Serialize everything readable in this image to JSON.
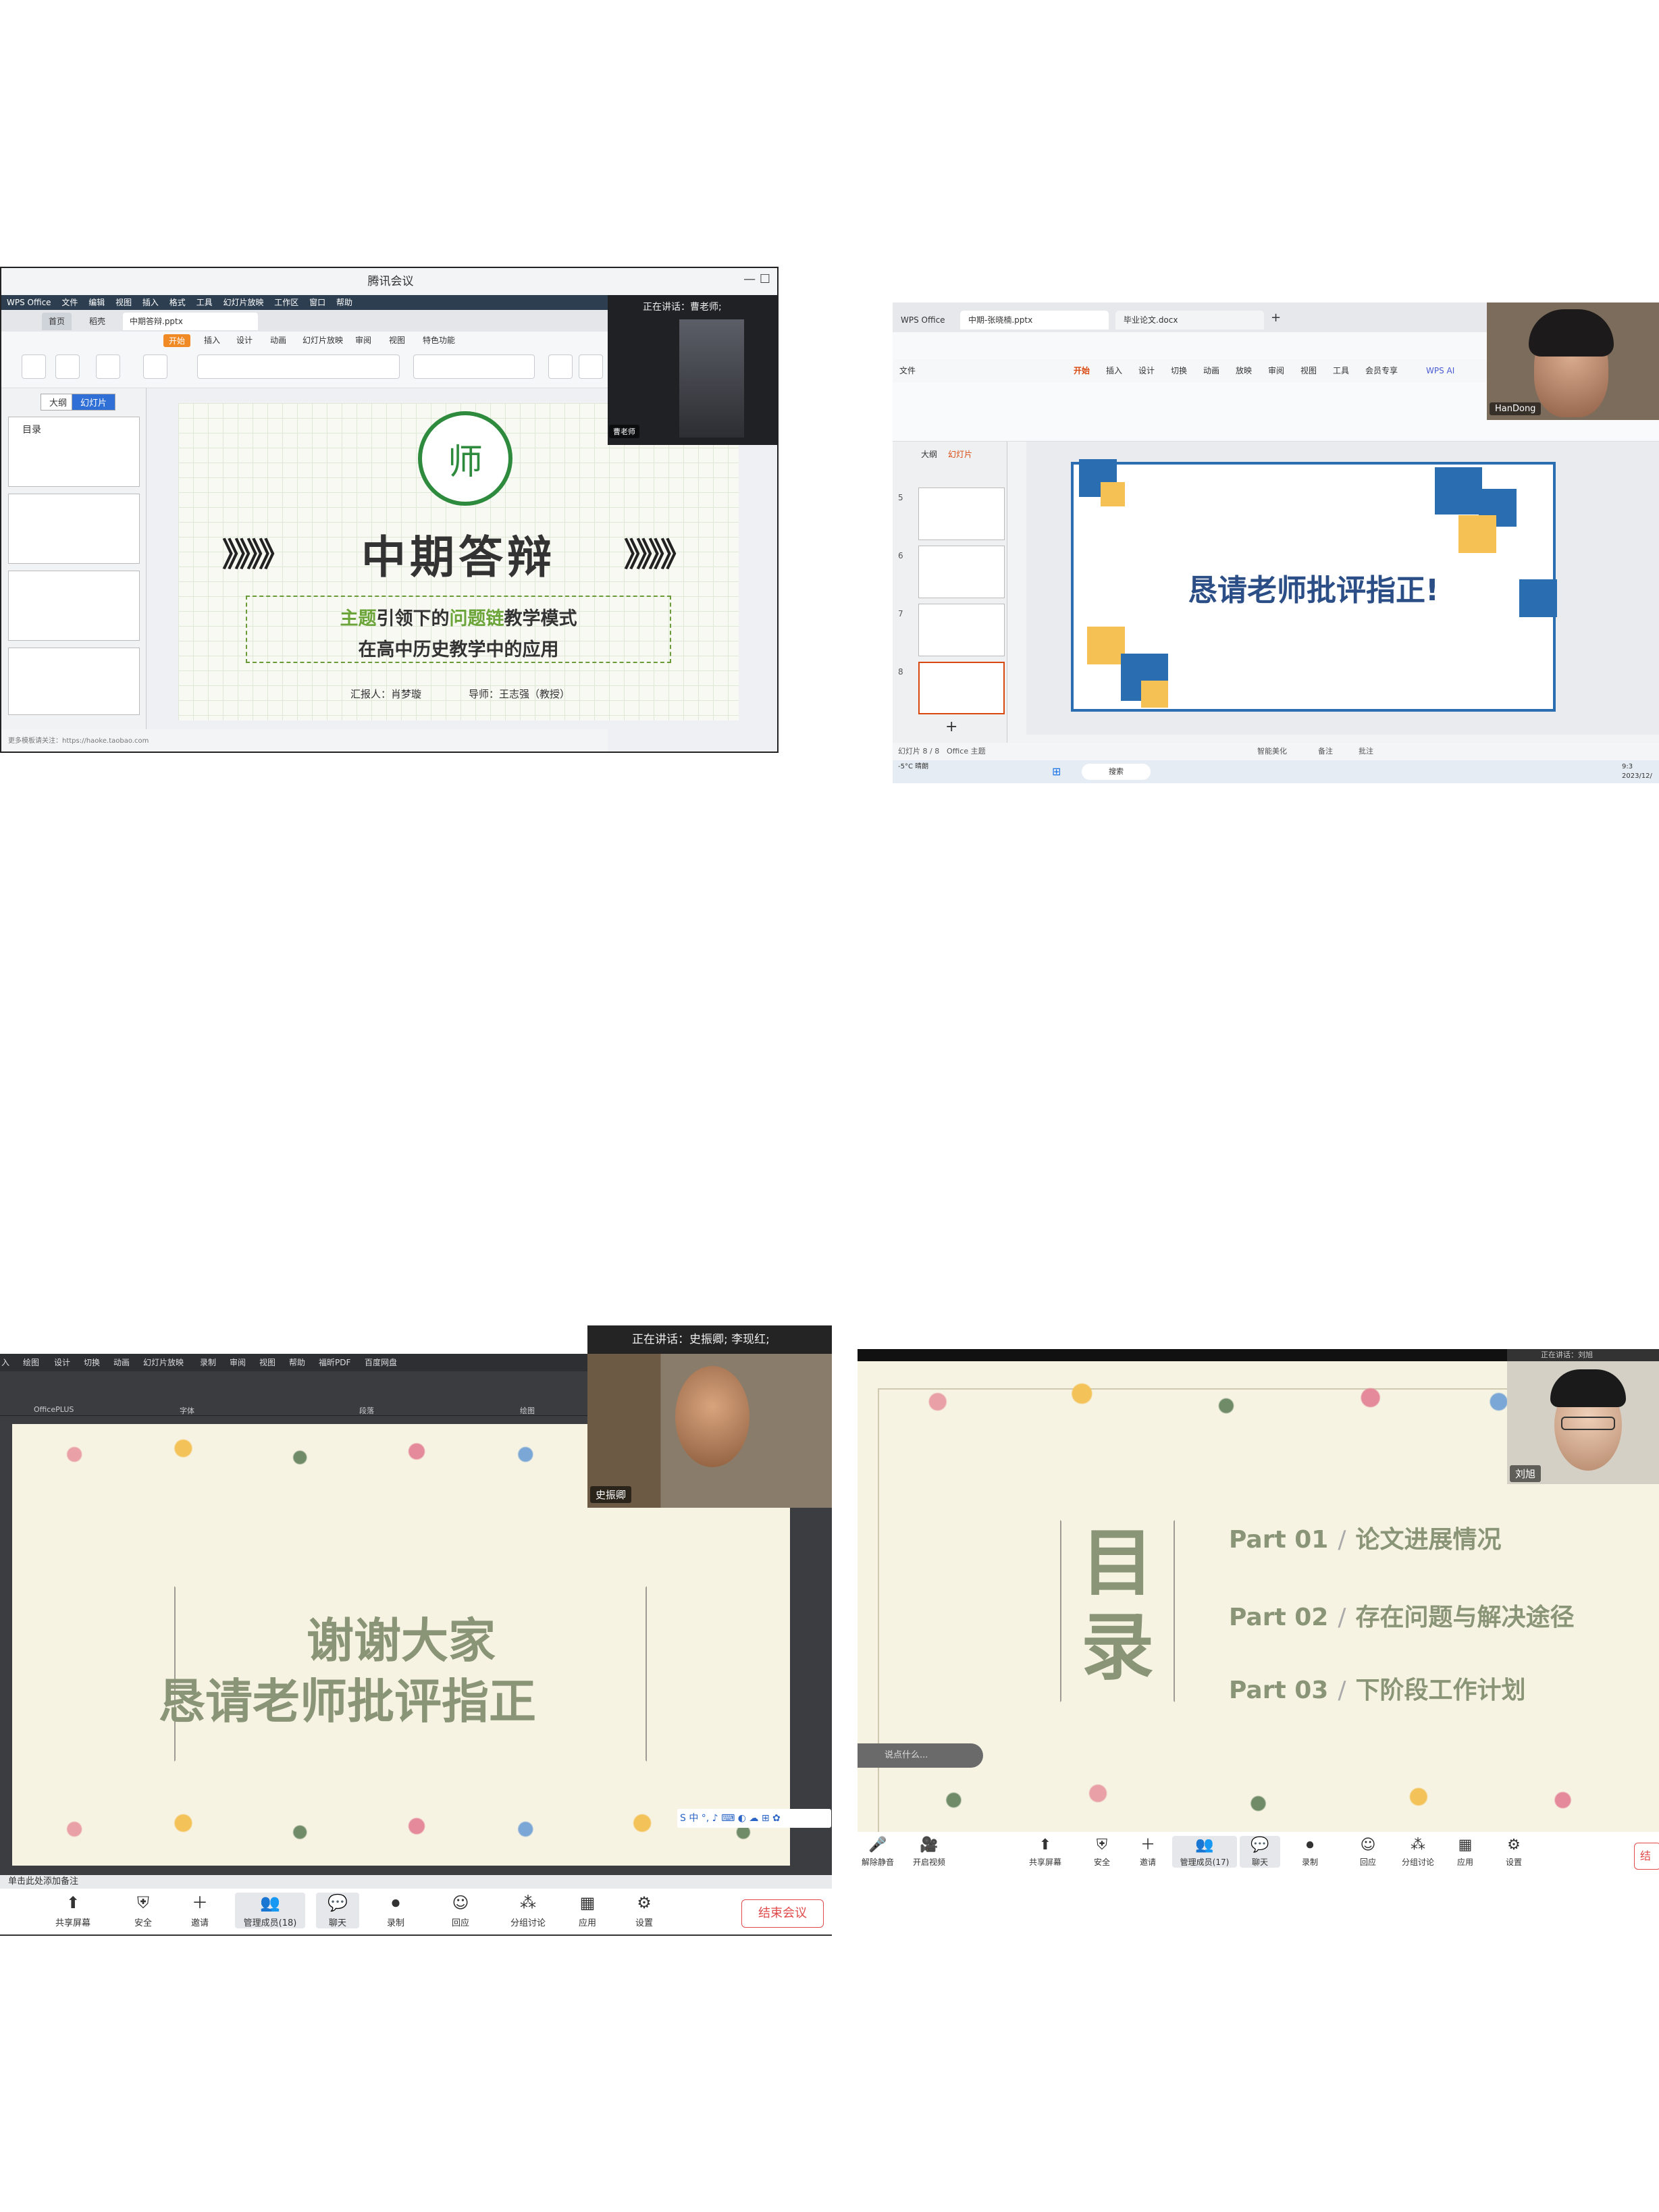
{
  "panel1": {
    "window_title": "腾讯会议",
    "menubar": [
      "WPS Office",
      "文件",
      "编辑",
      "视图",
      "插入",
      "格式",
      "工具",
      "幻灯片放映",
      "工作区",
      "窗口",
      "帮助"
    ],
    "tabs": [
      {
        "label": "首页"
      },
      {
        "label": "稻壳"
      },
      {
        "label": "中期答辩.pptx"
      }
    ],
    "ribbon_tabs": [
      "开始",
      "插入",
      "设计",
      "动画",
      "幻灯片放映",
      "审阅",
      "视图",
      "特色功能"
    ],
    "ribbon_active": "开始",
    "sidebar_tabs": [
      "大纲",
      "幻灯片"
    ],
    "thumb_labels": [
      "目录"
    ],
    "slide": {
      "logo_glyph": "师",
      "title": "中期答辩",
      "chevrons": "》》》》",
      "subtitle_pre": "主题",
      "subtitle_mid1": "引领下的",
      "subtitle_hl": "问题链",
      "subtitle_post": "教学模式",
      "subtitle_line2": "在高中历史教学中的应用",
      "reporter": "汇报人：肖梦璇",
      "advisor": "导师：王志强（教授）"
    },
    "status": "更多模板请关注：https://haoke.taobao.com",
    "video": {
      "speaking": "正在讲话：曹老师;",
      "name": "曹老师"
    }
  },
  "panel2": {
    "file_tabs": [
      "WPS Office",
      "中期-张晓楠.pptx",
      "毕业论文.docx"
    ],
    "menu": [
      "文件",
      "开始",
      "插入",
      "设计",
      "切换",
      "动画",
      "放映",
      "审阅",
      "视图",
      "工具",
      "会员专享",
      "WPS AI"
    ],
    "active_menu": "开始",
    "side_tabs": [
      "大纲",
      "幻灯片"
    ],
    "slide_numbers": [
      "5",
      "6",
      "7",
      "8"
    ],
    "slide_text": "恳请老师批评指正!",
    "status_left": "幻灯片 8 / 8",
    "status_theme": "Office 主题",
    "status_right": [
      "智能美化",
      "备注",
      "批注"
    ],
    "taskbar_search": "搜索",
    "taskbar_weather": "-5°C 晴朗",
    "taskbar_time": "9:3",
    "taskbar_date": "2023/12/",
    "video": {
      "name": "HanDong"
    },
    "accent_blue": "#2b6db1",
    "accent_orange": "#f5c054"
  },
  "panel3": {
    "menu": [
      "入",
      "绘图",
      "设计",
      "切换",
      "动画",
      "幻灯片放映",
      "录制",
      "审阅",
      "视图",
      "帮助",
      "福昕PDF",
      "百度网盘"
    ],
    "group_labels": [
      "OfficePLUS",
      "字体",
      "段落",
      "绘图"
    ],
    "slide_line1": "谢谢大家",
    "slide_line2": "恳请老师批评指正",
    "note": "单击此处添加备注",
    "ime": "S 中 °, ♪ ⌨ ◐ ☁ ⊞ ✿",
    "video": {
      "speaking": "正在讲话：史振卿; 李现红;",
      "name": "史振卿"
    },
    "toolbar": [
      {
        "label": "共享屏幕",
        "icon": "⬆"
      },
      {
        "label": "安全",
        "icon": "⛨"
      },
      {
        "label": "邀请",
        "icon": "＋"
      },
      {
        "label": "管理成员(18)",
        "icon": "👥"
      },
      {
        "label": "聊天",
        "icon": "💬"
      },
      {
        "label": "录制",
        "icon": "⏺"
      },
      {
        "label": "回应",
        "icon": "☺"
      },
      {
        "label": "分组讨论",
        "icon": "⁂"
      },
      {
        "label": "应用",
        "icon": "▦"
      },
      {
        "label": "设置",
        "icon": "⚙"
      }
    ],
    "end_label": "结束会议"
  },
  "panel4": {
    "mulu": [
      "目",
      "录"
    ],
    "parts": [
      {
        "num": "Part 01",
        "title": "论文进展情况"
      },
      {
        "num": "Part 02",
        "title": "存在问题与解决途径"
      },
      {
        "num": "Part 03",
        "title": "下阶段工作计划"
      }
    ],
    "pill": "说点什么...",
    "video": {
      "speaking": "正在讲话：刘旭",
      "name": "刘旭"
    },
    "toolbar": [
      {
        "label": "解除静音",
        "icon": "🎤"
      },
      {
        "label": "开启视频",
        "icon": "🎥"
      },
      {
        "label": "共享屏幕",
        "icon": "⬆"
      },
      {
        "label": "安全",
        "icon": "⛨"
      },
      {
        "label": "邀请",
        "icon": "＋"
      },
      {
        "label": "管理成员(17)",
        "icon": "👥"
      },
      {
        "label": "聊天",
        "icon": "💬"
      },
      {
        "label": "录制",
        "icon": "⏺"
      },
      {
        "label": "回应",
        "icon": "☺"
      },
      {
        "label": "分组讨论",
        "icon": "⁂"
      },
      {
        "label": "应用",
        "icon": "▦"
      },
      {
        "label": "设置",
        "icon": "⚙"
      }
    ],
    "end_label": "结"
  }
}
